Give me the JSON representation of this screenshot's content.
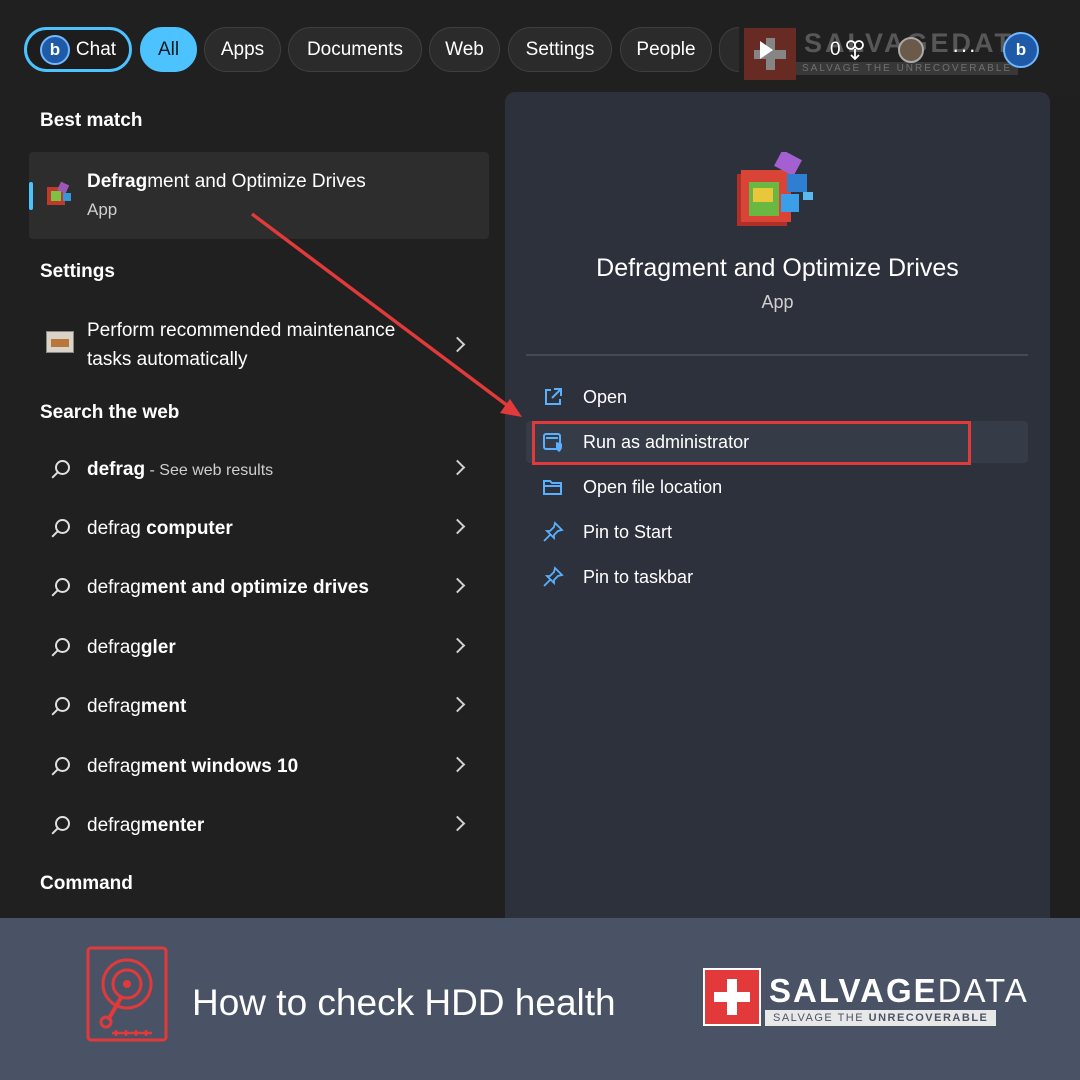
{
  "filter_bar": {
    "chat": "Chat",
    "tabs": [
      "All",
      "Apps",
      "Documents",
      "Web",
      "Settings",
      "People"
    ],
    "points": "0",
    "more": "···"
  },
  "watermark": {
    "brand": "SALVAGEDATA",
    "tagline": "SALVAGE THE UNRECOVERABLE"
  },
  "left": {
    "best_match_heading": "Best match",
    "best_match": {
      "title_bold": "Defrag",
      "title_rest": "ment and Optimize Drives",
      "subtitle": "App"
    },
    "settings_heading": "Settings",
    "settings_item": "Perform recommended maintenance tasks automatically",
    "web_heading": "Search the web",
    "web_results": [
      {
        "query": "defrag",
        "bold": "",
        "hint": " - See web results"
      },
      {
        "query": "defrag",
        "bold": " computer",
        "hint": ""
      },
      {
        "query": "defrag",
        "bold": "ment and optimize drives",
        "hint": ""
      },
      {
        "query": "defrag",
        "bold": "gler",
        "hint": ""
      },
      {
        "query": "defrag",
        "bold": "ment",
        "hint": ""
      },
      {
        "query": "defrag",
        "bold": "ment windows 10",
        "hint": ""
      },
      {
        "query": "defrag",
        "bold": "menter",
        "hint": ""
      }
    ],
    "command_heading": "Command"
  },
  "preview": {
    "title": "Defragment and Optimize Drives",
    "subtitle": "App",
    "actions": [
      "Open",
      "Run as administrator",
      "Open file location",
      "Pin to Start",
      "Pin to taskbar"
    ],
    "icons": [
      "open-external-icon",
      "shield-admin-icon",
      "folder-icon",
      "pin-icon",
      "pin-icon"
    ]
  },
  "banner": {
    "title": "How to check HDD health",
    "brand_bold": "SALVAGE",
    "brand_rest": "DATA",
    "tag_normal": "SALVAGE THE ",
    "tag_bold": "UNRECOVERABLE"
  },
  "colors": {
    "accent": "#4cc2ff",
    "highlight": "#e23a3a",
    "banner": "#4a5366",
    "panel": "#2c313b"
  }
}
